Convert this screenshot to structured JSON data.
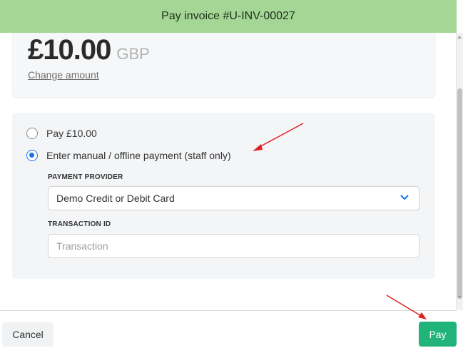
{
  "header": {
    "title": "Pay invoice #U-INV-00027"
  },
  "amount": {
    "value": "£10.00",
    "currency": "GBP",
    "change_link": "Change amount"
  },
  "payment_options": [
    {
      "label": "Pay £10.00",
      "selected": false
    },
    {
      "label": "Enter manual / offline payment (staff only)",
      "selected": true
    }
  ],
  "provider": {
    "label": "PAYMENT PROVIDER",
    "value": "Demo Credit or Debit Card"
  },
  "transaction": {
    "label": "TRANSACTION ID",
    "placeholder": "Transaction",
    "value": ""
  },
  "footer": {
    "cancel_label": "Cancel",
    "pay_label": "Pay"
  },
  "colors": {
    "header_bg": "#a4d796",
    "pay_button": "#20b47a",
    "radio_accent": "#1a73e8",
    "annotation_arrow": "#e02020"
  },
  "icons": {
    "select_chevron": "chevron-down-icon",
    "annotation": "red-arrow-icon"
  }
}
